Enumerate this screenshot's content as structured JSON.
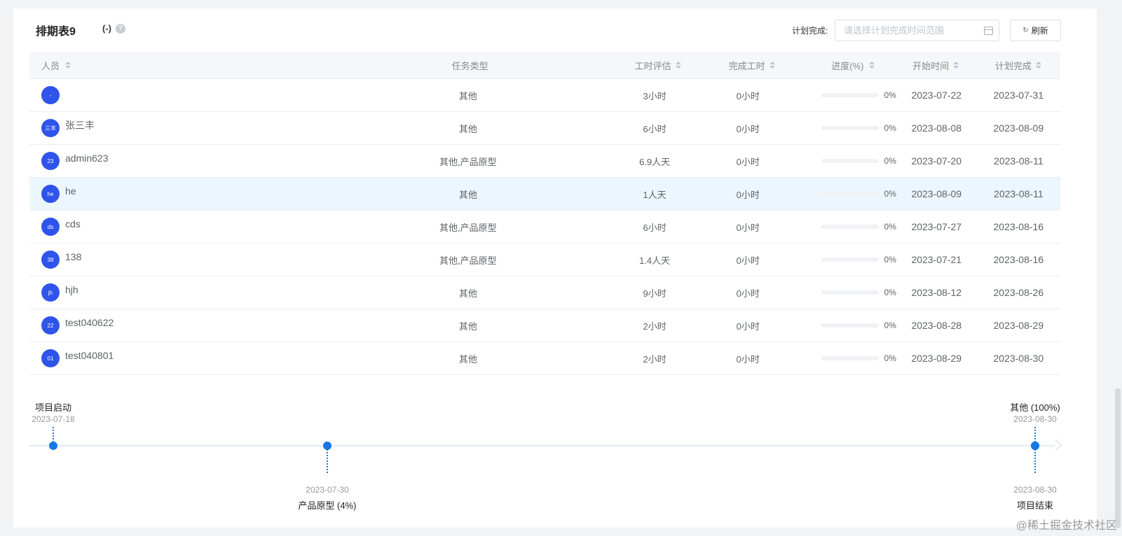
{
  "header": {
    "title": "排期表9",
    "count": "(-)",
    "help_icon": "?",
    "filter_label": "计划完成:",
    "date_placeholder": "请选择计划完成时间范围",
    "refresh_label": "刷新"
  },
  "table": {
    "columns": {
      "person": "人员",
      "type": "任务类型",
      "hours": "工时评估",
      "done": "完成工时",
      "progress": "进度(%)",
      "start": "开始时间",
      "end": "计划完成"
    },
    "rows": [
      {
        "avatar": "-",
        "name": "",
        "type": "其他",
        "hours": "3小时",
        "done": "0小时",
        "progress": 0,
        "progress_text": "0%",
        "start": "2023-07-22",
        "end": "2023-07-31",
        "highlighted": false
      },
      {
        "avatar": "三丰",
        "name": "张三丰",
        "type": "其他",
        "hours": "6小时",
        "done": "0小时",
        "progress": 0,
        "progress_text": "0%",
        "start": "2023-08-08",
        "end": "2023-08-09",
        "highlighted": false
      },
      {
        "avatar": "23",
        "name": "admin623",
        "type": "其他,产品原型",
        "hours": "6.9人天",
        "done": "0小时",
        "progress": 0,
        "progress_text": "0%",
        "start": "2023-07-20",
        "end": "2023-08-11",
        "highlighted": false
      },
      {
        "avatar": "he",
        "name": "he",
        "type": "其他",
        "hours": "1人天",
        "done": "0小时",
        "progress": 0,
        "progress_text": "0%",
        "start": "2023-08-09",
        "end": "2023-08-11",
        "highlighted": true
      },
      {
        "avatar": "ds",
        "name": "cds",
        "type": "其他,产品原型",
        "hours": "6小时",
        "done": "0小时",
        "progress": 0,
        "progress_text": "0%",
        "start": "2023-07-27",
        "end": "2023-08-16",
        "highlighted": false
      },
      {
        "avatar": "38",
        "name": "138",
        "type": "其他,产品原型",
        "hours": "1.4人天",
        "done": "0小时",
        "progress": 0,
        "progress_text": "0%",
        "start": "2023-07-21",
        "end": "2023-08-16",
        "highlighted": false
      },
      {
        "avatar": "jh",
        "name": "hjh",
        "type": "其他",
        "hours": "9小时",
        "done": "0小时",
        "progress": 0,
        "progress_text": "0%",
        "start": "2023-08-12",
        "end": "2023-08-26",
        "highlighted": false
      },
      {
        "avatar": "22",
        "name": "test040622",
        "type": "其他",
        "hours": "2小时",
        "done": "0小时",
        "progress": 0,
        "progress_text": "0%",
        "start": "2023-08-28",
        "end": "2023-08-29",
        "highlighted": false
      },
      {
        "avatar": "01",
        "name": "test040801",
        "type": "其他",
        "hours": "2小时",
        "done": "0小时",
        "progress": 0,
        "progress_text": "0%",
        "start": "2023-08-29",
        "end": "2023-08-30",
        "highlighted": false
      }
    ]
  },
  "timeline": {
    "start": "2023-07-18",
    "end": "2023-08-30",
    "milestones": [
      {
        "name": "项目启动",
        "date": "2023-07-18",
        "side": "top"
      },
      {
        "name": "产品原型 (4%)",
        "date": "2023-07-30",
        "side": "bottom"
      },
      {
        "name": "其他 (100%)",
        "date": "2023-08-30",
        "side": "top"
      },
      {
        "name": "项目结束",
        "date": "2023-08-30",
        "side": "bottom"
      }
    ]
  },
  "watermark": "@稀土掘金技术社区",
  "colors": {
    "accent": "#1677e6",
    "avatar": "#2f54eb",
    "row_highlight": "#ecf6fe"
  }
}
